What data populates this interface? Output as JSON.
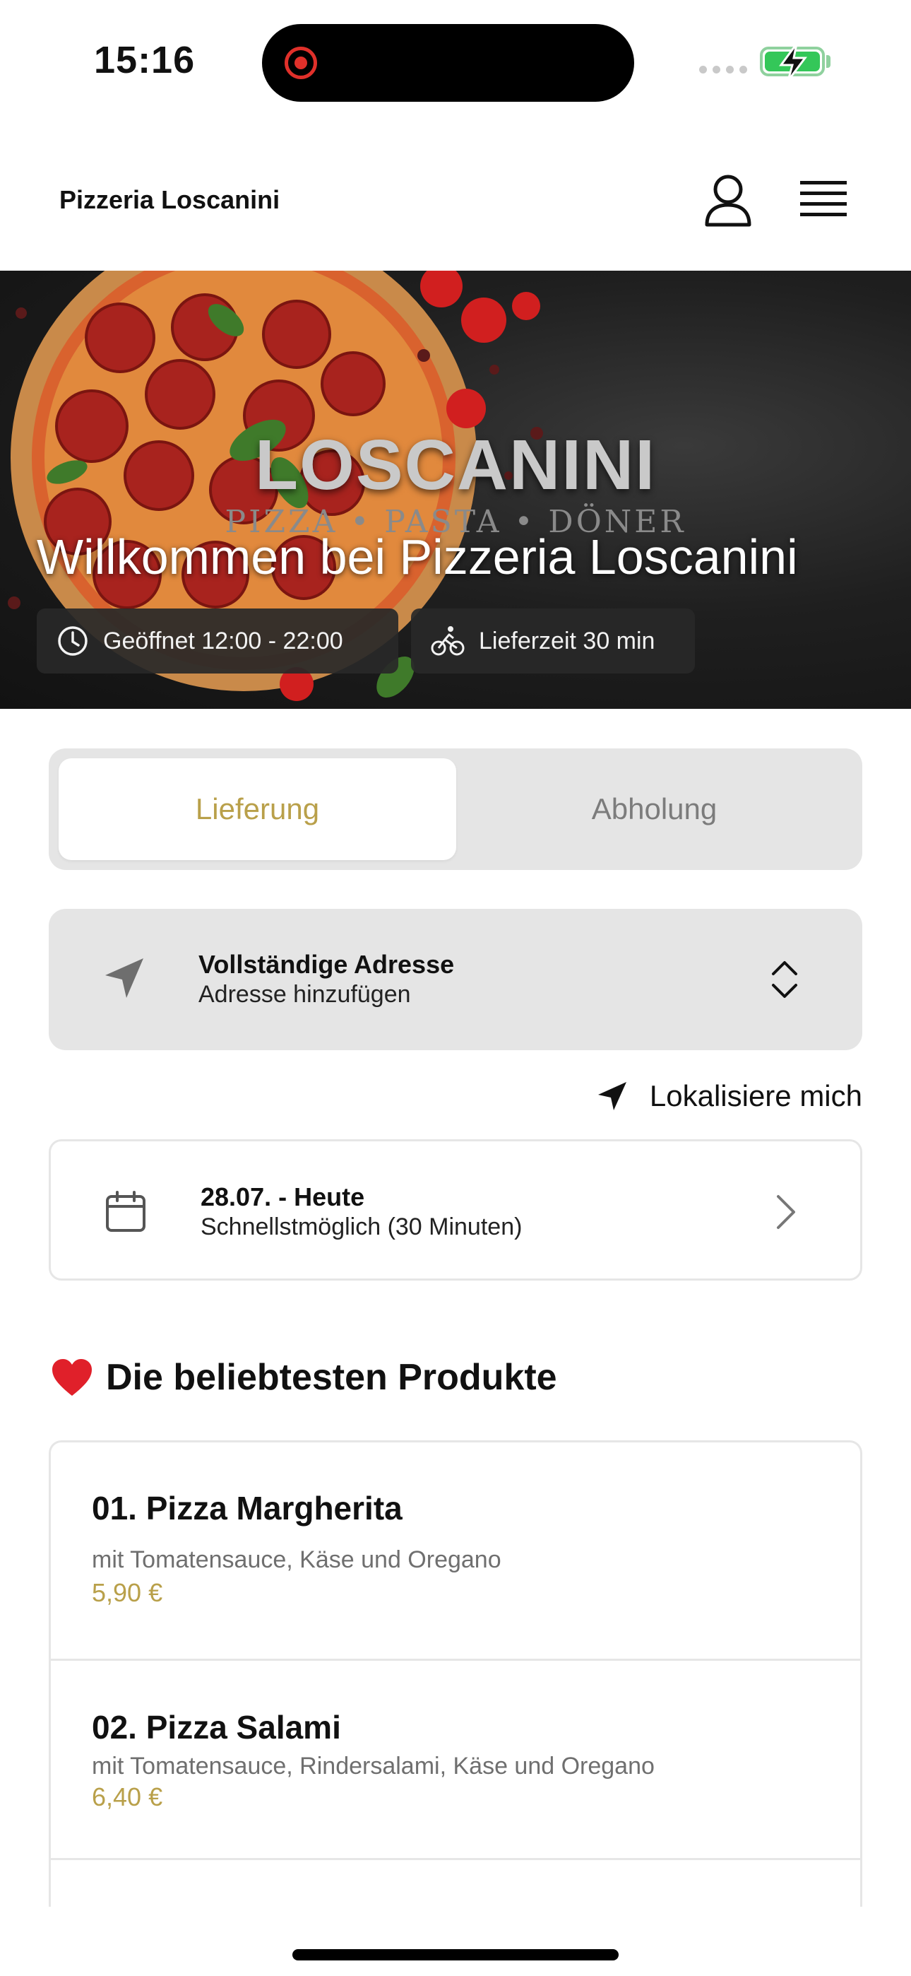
{
  "status_bar": {
    "time": "15:16",
    "colors": {
      "recording": "#e0302a",
      "battery": "#34c759"
    }
  },
  "header": {
    "brand": "Pizzeria Loscanini",
    "icons": [
      "user-icon",
      "menu-icon"
    ]
  },
  "hero": {
    "logo_text": "LOSCANINI",
    "tagline": "PIZZA • PASTA • DÖNER",
    "title": "Willkommen bei Pizzeria Loscanini",
    "opening_hours": "Geöffnet 12:00 - 22:00",
    "delivery_time": "Lieferzeit 30 min"
  },
  "order_mode": {
    "options": [
      "Lieferung",
      "Abholung"
    ],
    "selected": "Lieferung",
    "accent_color": "#b9a04a"
  },
  "address": {
    "title": "Vollständige Adresse",
    "subtitle": "Adresse hinzufügen"
  },
  "locate_label": "Lokalisiere mich",
  "schedule": {
    "date": "28.07. - Heute",
    "time": "Schnellstmöglich (30 Minuten)"
  },
  "popular": {
    "heading": "Die beliebtesten Produkte",
    "products": [
      {
        "name": "01. Pizza Margherita",
        "description": "mit Tomatensauce, Käse und Oregano",
        "price": "5,90 €"
      },
      {
        "name": "02. Pizza Salami",
        "description": "mit Tomatensauce, Rindersalami, Käse und Oregano",
        "price": "6,40 €"
      }
    ]
  }
}
